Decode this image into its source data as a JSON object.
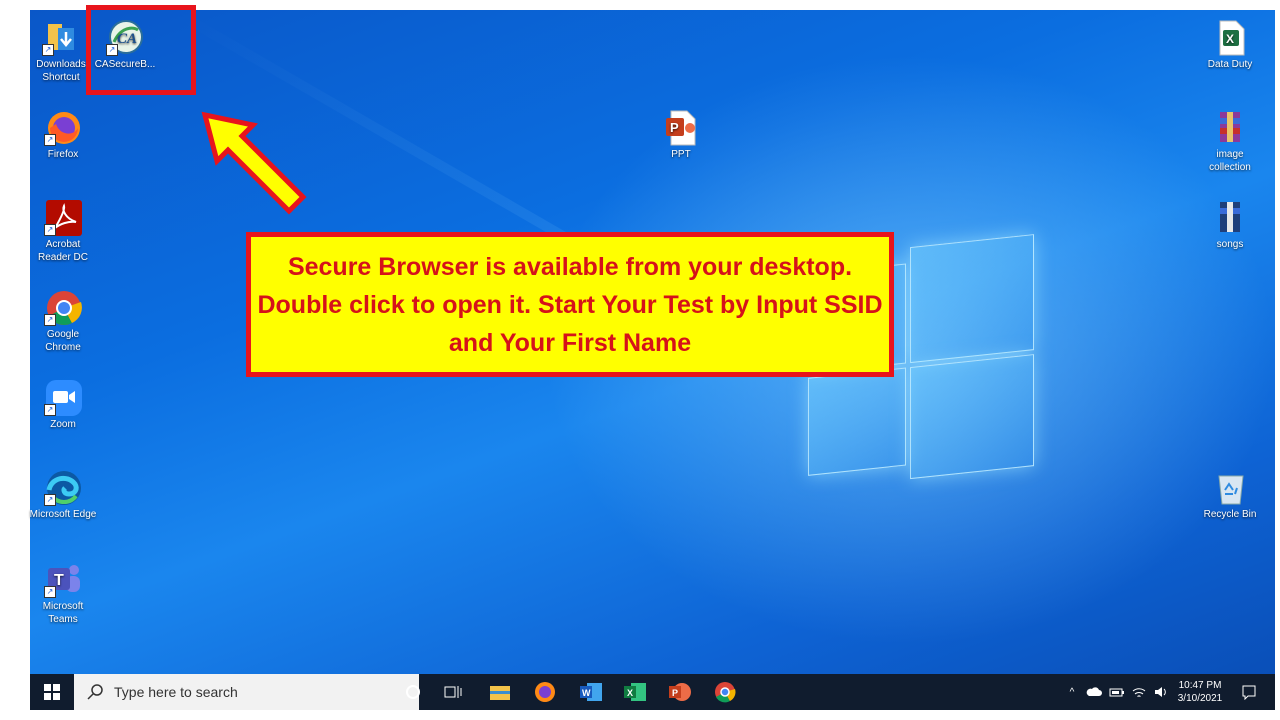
{
  "desktop": {
    "icons_left": [
      {
        "label": "Downloads Shortcut",
        "icon": "folder-icon"
      },
      {
        "label": "CASecureB...",
        "icon": "ca-secure-browser-icon"
      },
      {
        "label": "Firefox",
        "icon": "firefox-icon"
      },
      {
        "label": "Acrobat Reader DC",
        "icon": "acrobat-icon"
      },
      {
        "label": "Google Chrome",
        "icon": "chrome-icon"
      },
      {
        "label": "Zoom",
        "icon": "zoom-icon"
      },
      {
        "label": "Microsoft Edge",
        "icon": "edge-icon"
      },
      {
        "label": "Microsoft Teams",
        "icon": "teams-icon"
      }
    ],
    "icons_center": [
      {
        "label": "PPT",
        "icon": "powerpoint-file-icon"
      }
    ],
    "icons_right": [
      {
        "label": "Data Duty",
        "icon": "excel-file-icon"
      },
      {
        "label": "image collection",
        "icon": "winrar-archive-icon"
      },
      {
        "label": "songs",
        "icon": "winrar-archive-icon"
      },
      {
        "label": "Recycle Bin",
        "icon": "recycle-bin-icon"
      }
    ]
  },
  "callout": {
    "text": "Secure Browser is available from your desktop. Double click to open it. Start Your Test by Input SSID and Your First Name"
  },
  "taskbar": {
    "search_placeholder": "Type here to search",
    "pinned": [
      "cortana-icon",
      "task-view-icon",
      "file-explorer-icon",
      "firefox-icon",
      "word-icon",
      "excel-icon",
      "powerpoint-icon",
      "chrome-icon"
    ],
    "time": "10:47 PM",
    "date": "3/10/2021"
  },
  "colors": {
    "accent_red": "#e8141c",
    "callout_fill": "#ffff00",
    "taskbar": "#101c2e"
  }
}
